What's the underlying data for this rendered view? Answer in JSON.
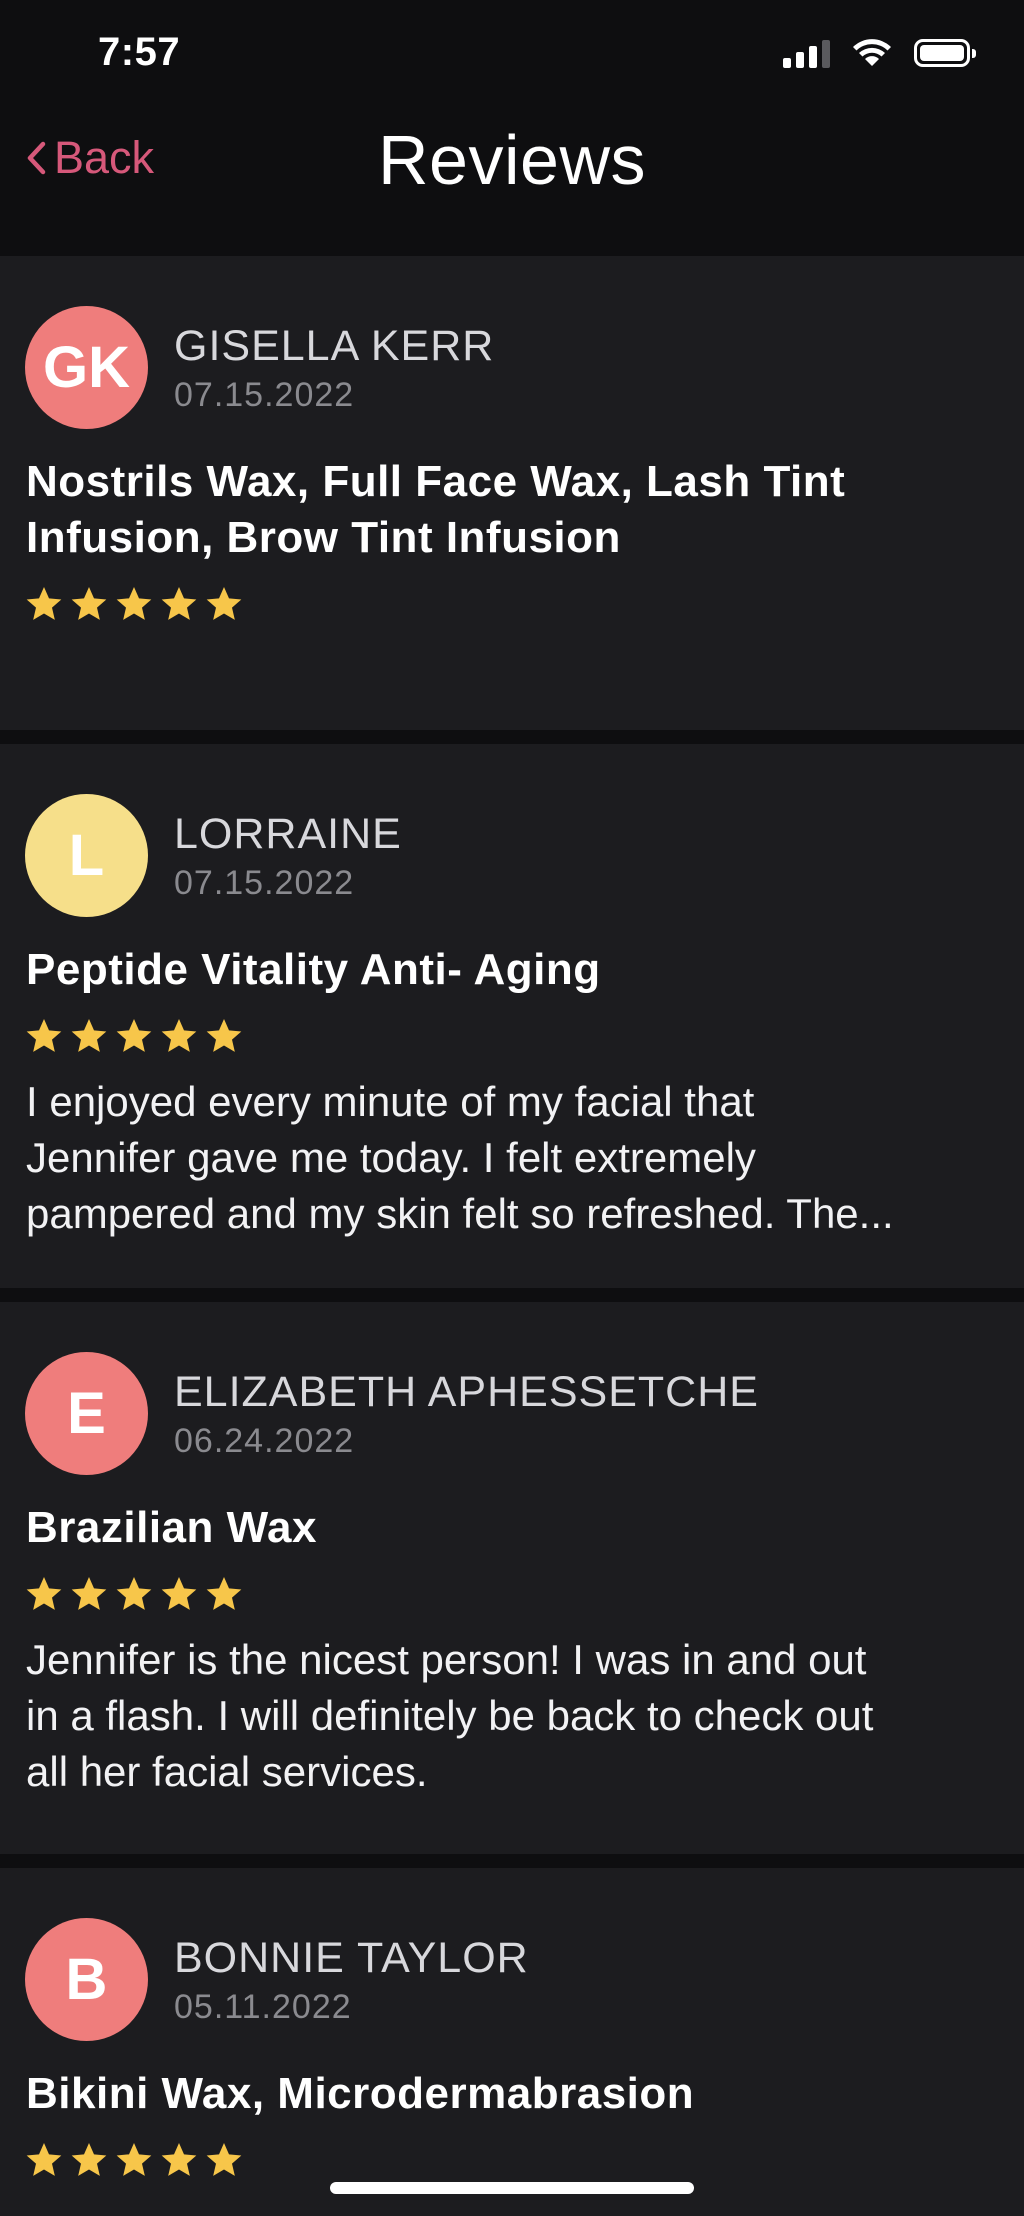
{
  "status_bar": {
    "time": "7:57",
    "icons": [
      "cellular-signal-icon",
      "wifi-icon",
      "battery-icon"
    ]
  },
  "nav": {
    "back_label": "Back",
    "title": "Reviews"
  },
  "colors": {
    "accent": "#d6587a",
    "star": "#f7c64a",
    "card_background": "#1c1c1f",
    "page_background": "#0e0e10",
    "avatar_salmon": "#ef7d7c",
    "avatar_yellow": "#f6df8a"
  },
  "reviews": [
    {
      "initials": "GK",
      "avatar_color": "#ef7d7c",
      "name": "GISELLA KERR",
      "date": "07.15.2022",
      "services": [
        "Nostrils Wax, Full Face Wax, Lash Tint",
        "Infusion, Brow Tint Infusion"
      ],
      "rating": 5,
      "comment": []
    },
    {
      "initials": "L",
      "avatar_color": "#f6df8a",
      "name": "LORRAINE",
      "date": "07.15.2022",
      "services": [
        "Peptide Vitality Anti- Aging"
      ],
      "rating": 5,
      "comment": [
        "I enjoyed every minute of my facial that",
        "Jennifer gave me today. I felt extremely",
        "pampered and my skin felt so refreshed. The..."
      ]
    },
    {
      "initials": "E",
      "avatar_color": "#ef7d7c",
      "name": "ELIZABETH APHESSETCHE",
      "date": "06.24.2022",
      "services": [
        "Brazilian Wax"
      ],
      "rating": 5,
      "comment": [
        "Jennifer is the nicest person! I was in and out",
        "in a flash. I will definitely be back to check out",
        "all her facial services."
      ]
    },
    {
      "initials": "B",
      "avatar_color": "#ef7d7c",
      "name": "BONNIE TAYLOR",
      "date": "05.11.2022",
      "services": [
        "Bikini Wax, Microdermabrasion"
      ],
      "rating": 5,
      "comment": []
    }
  ]
}
